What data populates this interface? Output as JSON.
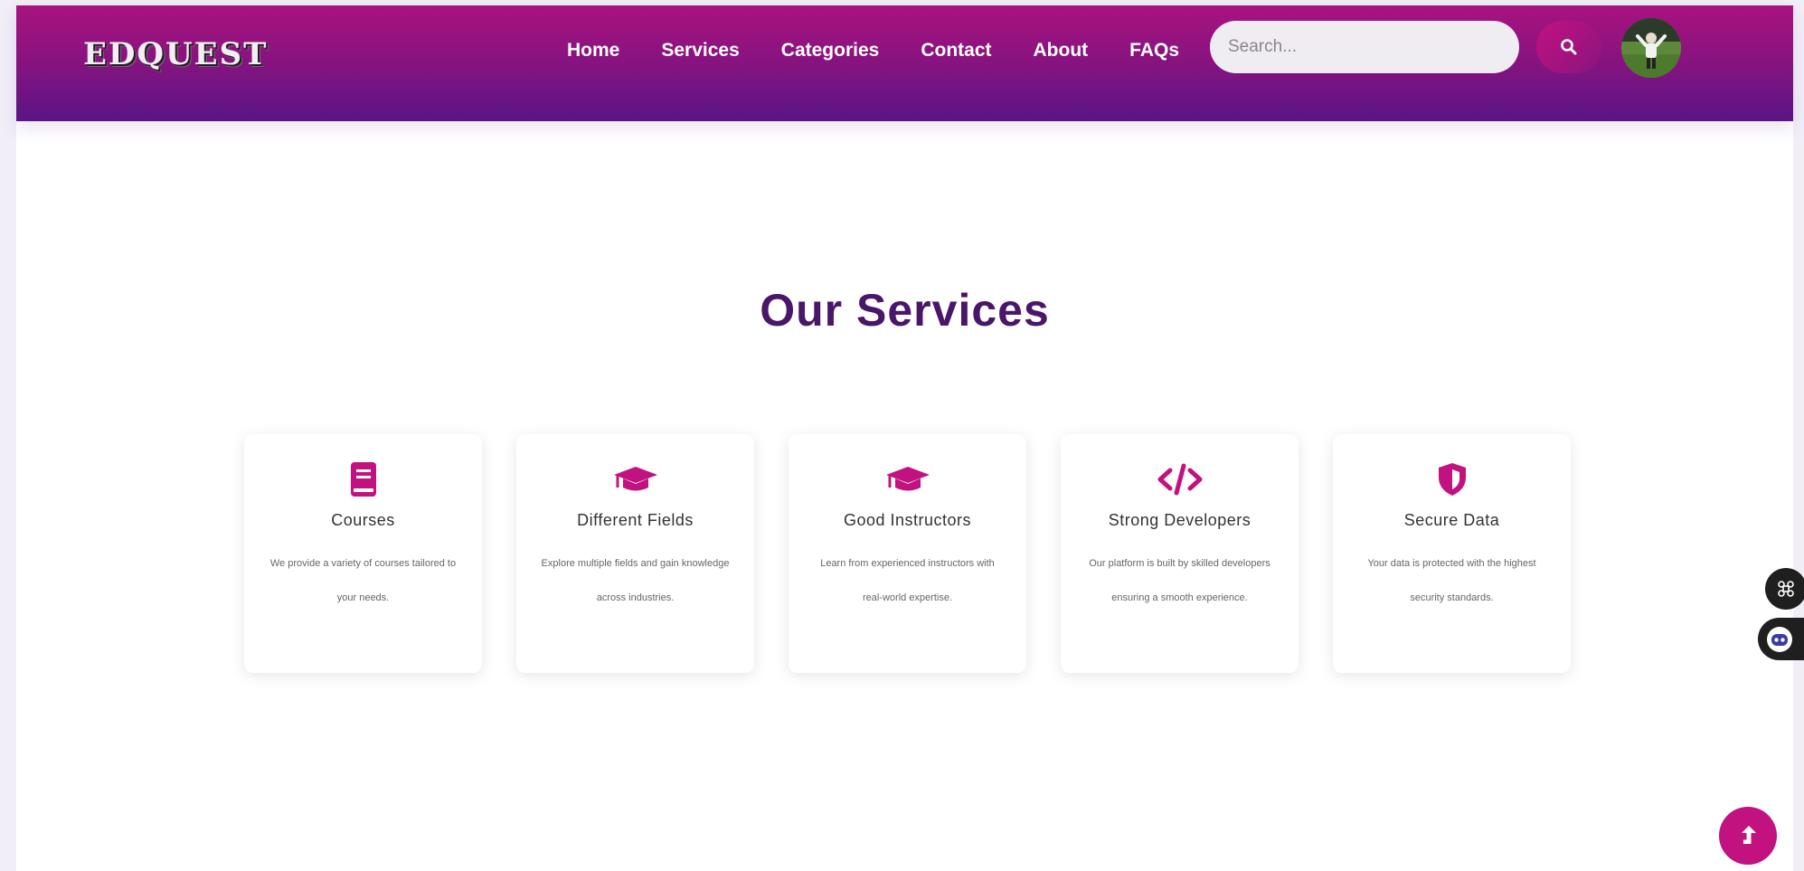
{
  "navbar": {
    "logo": "EDQUEST",
    "links": [
      "Home",
      "Services",
      "Categories",
      "Contact",
      "About",
      "FAQs"
    ],
    "search_placeholder": "Search...",
    "search_icon": "search-icon",
    "avatar_icon": "user-avatar"
  },
  "main": {
    "title": "Our Services",
    "cards": [
      {
        "icon": "book-icon",
        "title": "Courses",
        "desc": "We provide a variety of courses tailored to your needs."
      },
      {
        "icon": "graduation-cap-icon",
        "title": "Different Fields",
        "desc": "Explore multiple fields and gain knowledge across industries."
      },
      {
        "icon": "graduation-cap-icon",
        "title": "Good Instructors",
        "desc": "Learn from experienced instructors with real-world expertise."
      },
      {
        "icon": "code-icon",
        "title": "Strong Developers",
        "desc": "Our platform is built by skilled developers ensuring a smooth experience."
      },
      {
        "icon": "shield-icon",
        "title": "Secure Data",
        "desc": "Your data is protected with the highest security standards."
      }
    ]
  },
  "floating": {
    "grid_icon": "command-icon",
    "bot_icon": "chatbot-icon",
    "scroll_icon": "arrow-up-icon"
  },
  "colors": {
    "accent": "#c2127f",
    "header_top": "#a8137f",
    "header_bottom": "#5a1585",
    "title": "#4a1669"
  }
}
